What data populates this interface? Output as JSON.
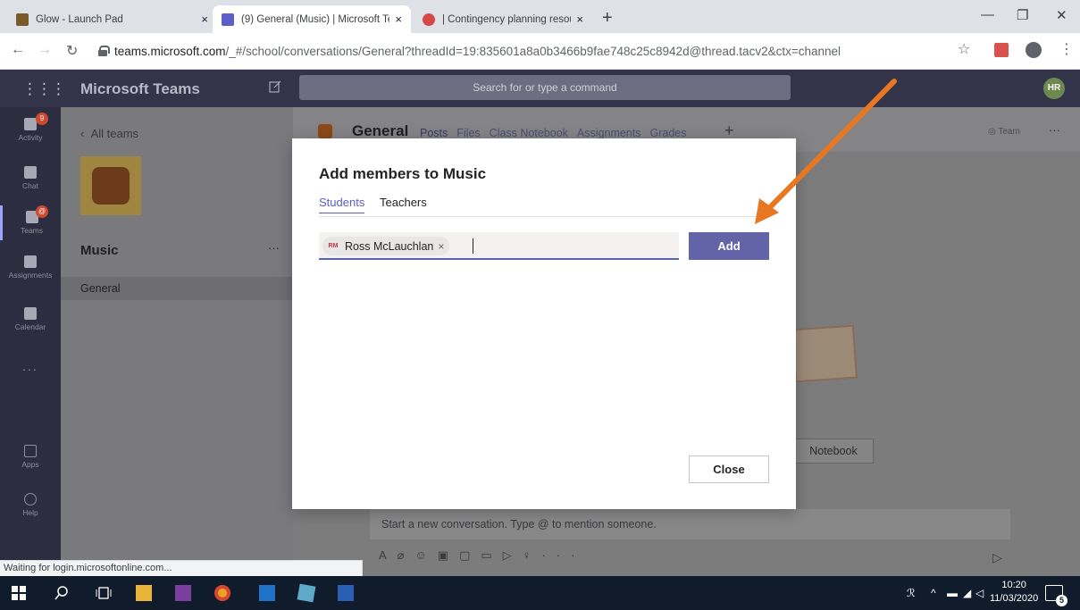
{
  "browser": {
    "tabs": [
      {
        "title": "Glow - Launch Pad",
        "close": "×"
      },
      {
        "title": "(9) General (Music) | Microsoft Te",
        "close": "×"
      },
      {
        "title": "| Contingency planning resource",
        "close": "×"
      }
    ],
    "new_tab": "+",
    "url_host": "teams.microsoft.com",
    "url_path": "/_#/school/conversations/General?threadId=19:835601a8a0b3466b9fae748c25c8942d@thread.tacv2&ctx=channel",
    "status_text": "Waiting for login.microsoftonline.com..."
  },
  "teams": {
    "app_title": "Microsoft Teams",
    "search_placeholder": "Search for or type a command",
    "user_initials": "HR",
    "rail": [
      {
        "label": "Activity",
        "icon": "bell-icon",
        "badge": "9"
      },
      {
        "label": "Chat",
        "icon": "chat-icon"
      },
      {
        "label": "Teams",
        "icon": "teams-icon",
        "badge": "@"
      },
      {
        "label": "Assignments",
        "icon": "assignments-icon"
      },
      {
        "label": "Calendar",
        "icon": "calendar-icon"
      },
      {
        "label": "...",
        "icon": "more-icon"
      },
      {
        "label": "Apps",
        "icon": "apps-icon"
      },
      {
        "label": "Help",
        "icon": "help-icon"
      }
    ],
    "sidebar": {
      "back_label": "All teams",
      "team_name": "Music",
      "more": "···",
      "channels": [
        "General"
      ]
    },
    "channel": {
      "title": "General",
      "tabs": [
        "Posts",
        "Files",
        "Class Notebook",
        "Assignments",
        "Grades"
      ],
      "add_tab": "+",
      "team_label": "Team",
      "more": "···",
      "notebook_button": "Notebook",
      "compose_placeholder": "Start a new conversation. Type @ to mention someone."
    }
  },
  "modal": {
    "title": "Add members to Music",
    "tabs": [
      "Students",
      "Teachers"
    ],
    "active_tab": "Students",
    "chip": {
      "initials": "RM",
      "name": "Ross McLauchlan",
      "remove": "×"
    },
    "add_label": "Add",
    "close_label": "Close"
  },
  "taskbar": {
    "time": "10:20",
    "date": "11/03/2020",
    "notifications": "5"
  },
  "colors": {
    "accent": "#6264a7",
    "arrow": "#e87722",
    "teams_header": "#33344a"
  }
}
